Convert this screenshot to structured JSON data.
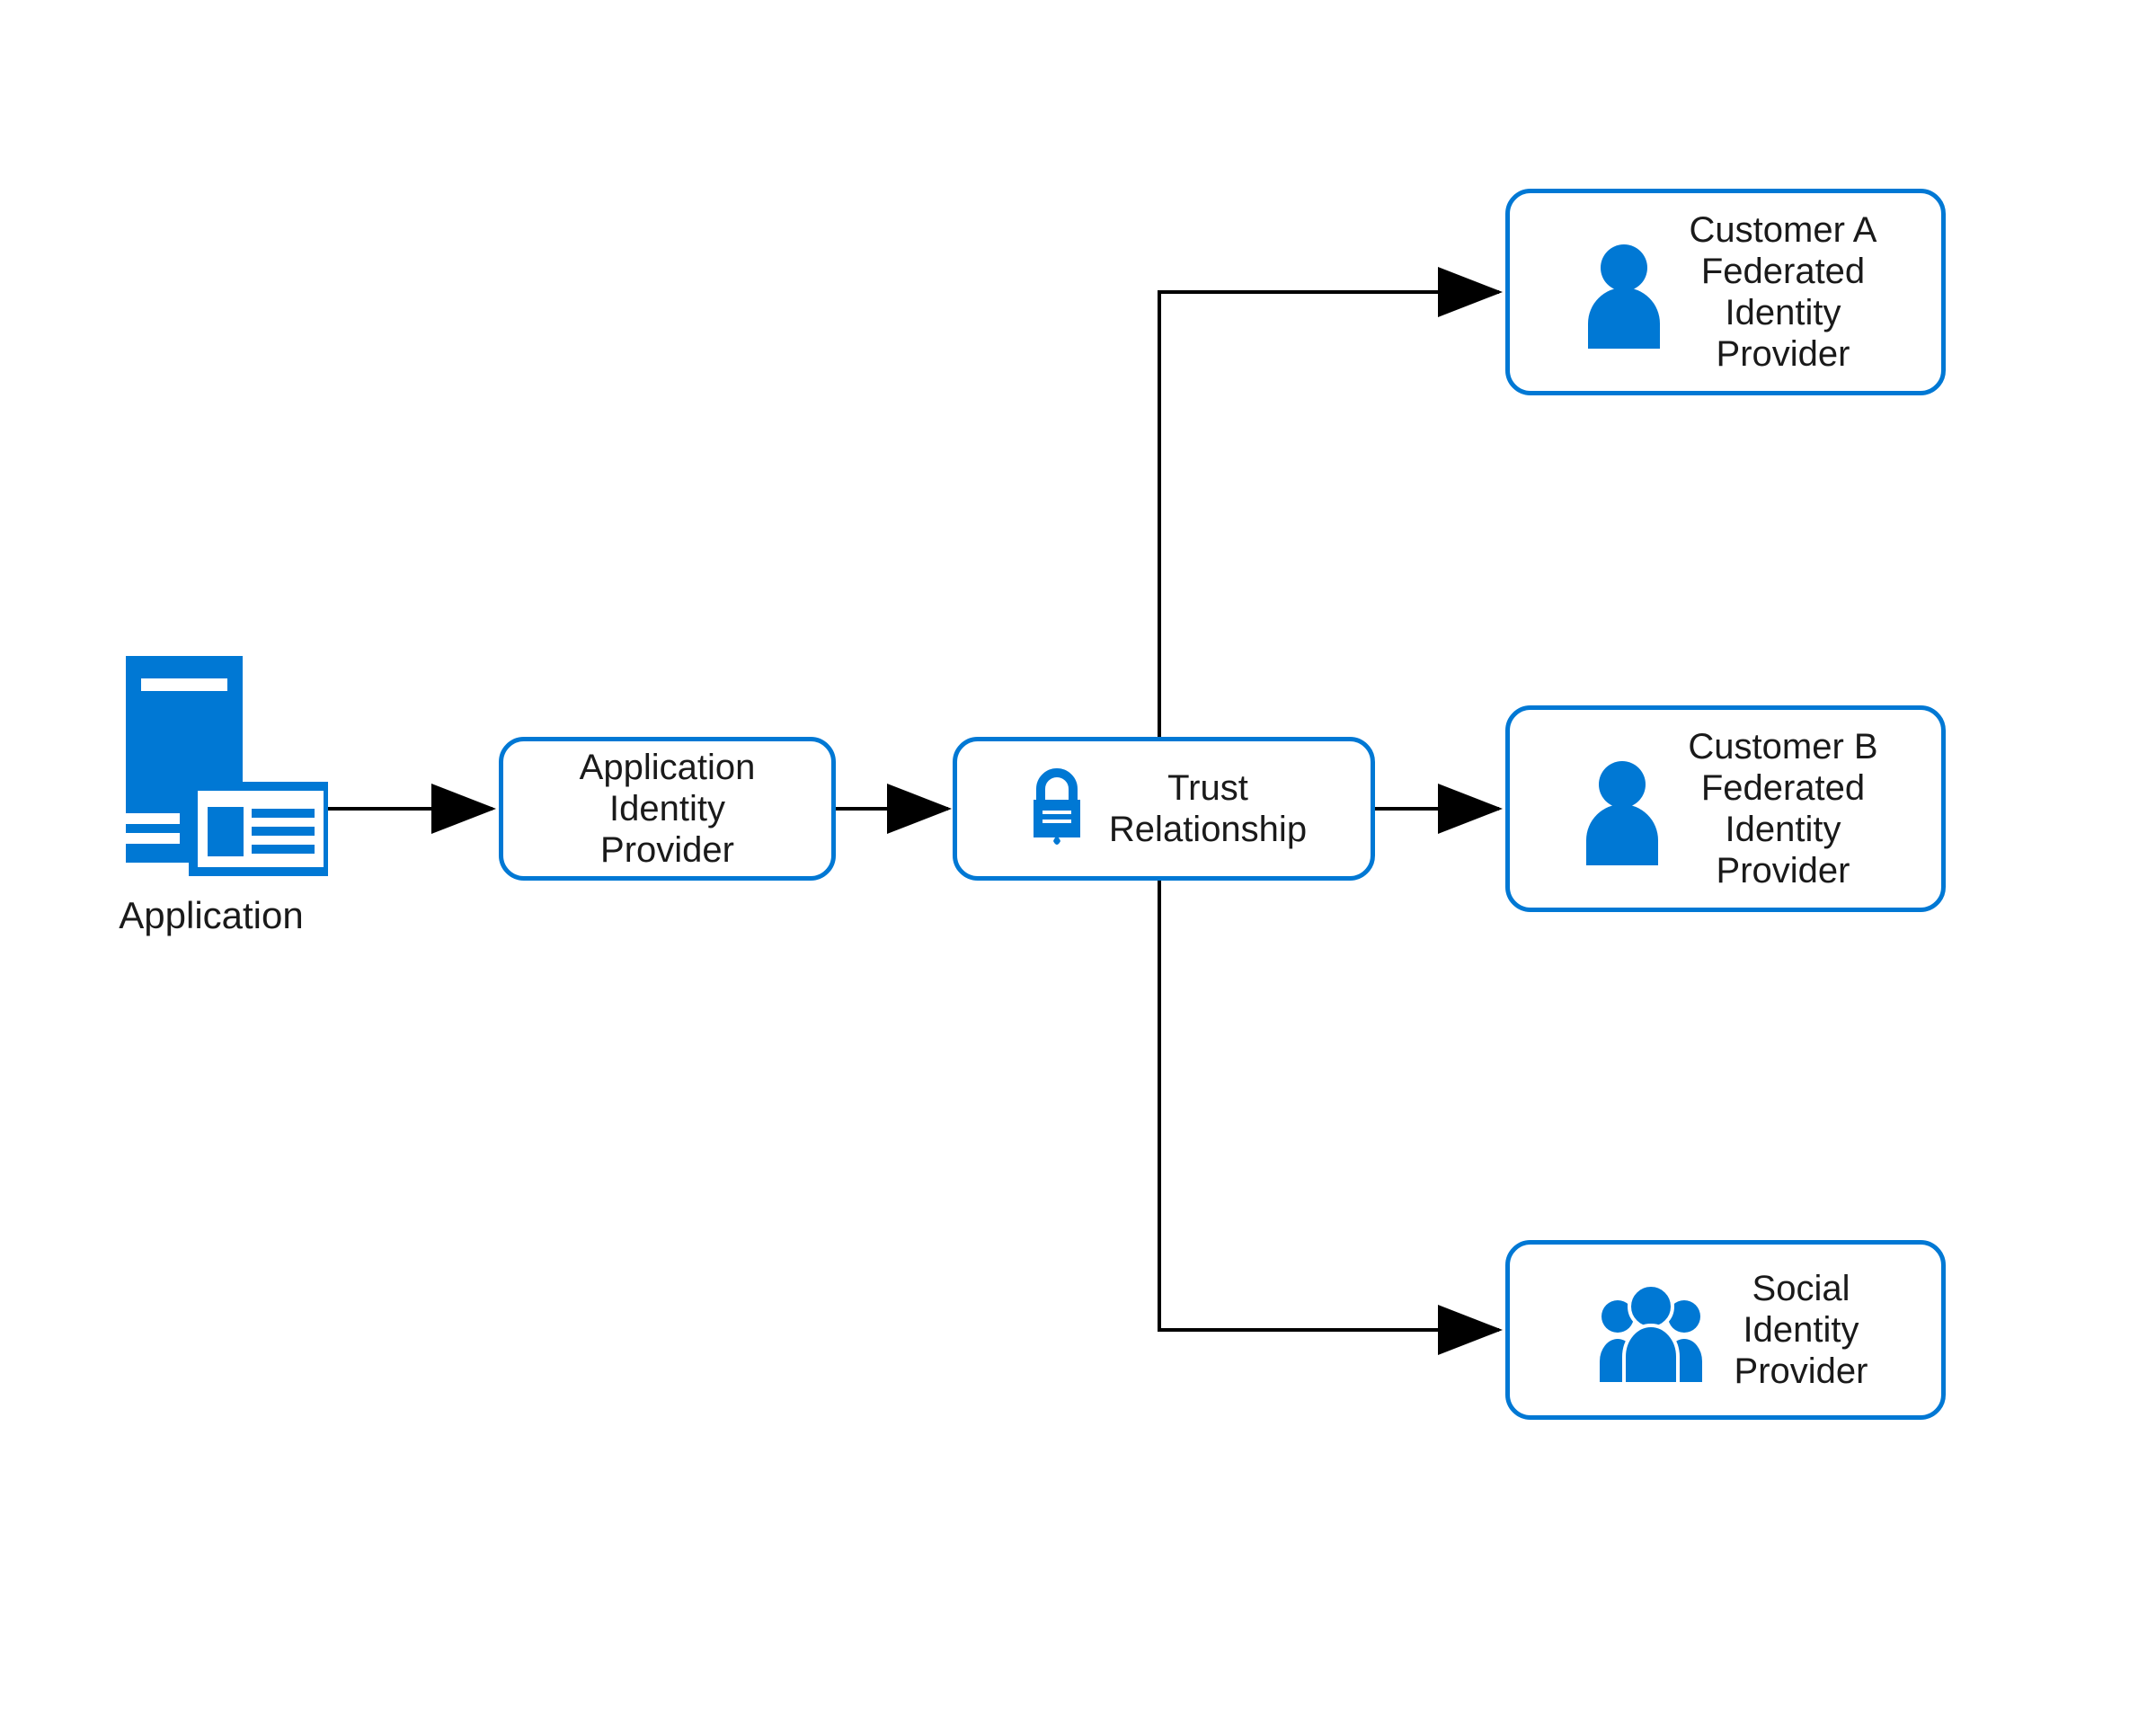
{
  "colors": {
    "azure_blue": "#0078d4"
  },
  "nodes": {
    "application": {
      "caption": "Application",
      "icon": "server-app-icon"
    },
    "app_idp": {
      "label": "Application\nIdentity\nProvider"
    },
    "trust": {
      "label": "Trust\nRelationship",
      "icon": "lock-icon"
    },
    "customer_a": {
      "label": "Customer A\nFederated\nIdentity\nProvider",
      "icon": "person-icon"
    },
    "customer_b": {
      "label": "Customer B\nFederated\nIdentity\nProvider",
      "icon": "person-icon"
    },
    "social": {
      "label": "Social\nIdentity\nProvider",
      "icon": "people-icon"
    }
  },
  "edges": [
    {
      "from": "application",
      "to": "app_idp"
    },
    {
      "from": "app_idp",
      "to": "trust"
    },
    {
      "from": "trust",
      "to": "customer_a"
    },
    {
      "from": "trust",
      "to": "customer_b"
    },
    {
      "from": "trust",
      "to": "social"
    }
  ]
}
